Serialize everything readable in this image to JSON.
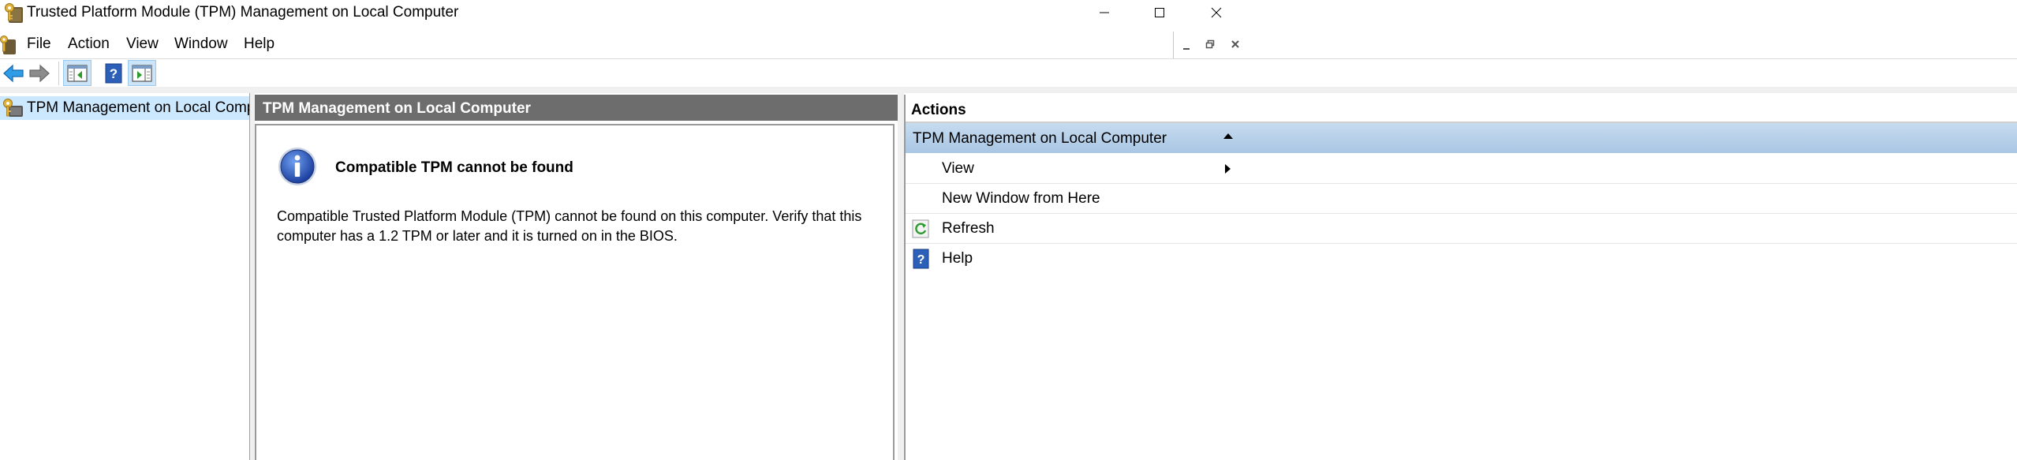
{
  "window": {
    "title": "Trusted Platform Module (TPM) Management on Local Computer",
    "app_icon": "tpm-key-icon",
    "controls": [
      "minimize-icon",
      "maximize-icon",
      "close-icon"
    ]
  },
  "menu": {
    "items": [
      "File",
      "Action",
      "View",
      "Window",
      "Help"
    ],
    "mdi_controls": [
      "mdi-minimize-icon",
      "mdi-restore-icon",
      "mdi-close-icon"
    ]
  },
  "toolbar": {
    "buttons": [
      "back-arrow-icon",
      "forward-arrow-icon",
      "show-hide-console-tree-icon",
      "help-icon",
      "show-hide-action-pane-icon"
    ]
  },
  "tree": {
    "items": [
      {
        "label": "TPM Management on Local Compute",
        "icon": "tpm-key-icon",
        "selected": true
      }
    ]
  },
  "center": {
    "header": "TPM Management on Local Computer",
    "message_title": "Compatible TPM cannot be found",
    "message_body": "Compatible Trusted Platform Module (TPM) cannot be found on this computer. Verify that this computer has a 1.2 TPM or later and it is turned on in the BIOS.",
    "icon": "info-icon"
  },
  "actions": {
    "header": "Actions",
    "group": "TPM Management on Local Computer",
    "items": [
      {
        "label": "View",
        "icon": "",
        "submenu": true
      },
      {
        "label": "New Window from Here",
        "icon": "",
        "submenu": false
      },
      {
        "label": "Refresh",
        "icon": "refresh-icon",
        "submenu": false
      },
      {
        "label": "Help",
        "icon": "help-icon",
        "submenu": false
      }
    ]
  },
  "colors": {
    "center_header_bg": "#6d6d6d",
    "tree_selection": "#cce8ff",
    "actions_group_bg": "#b4cfe9",
    "toolbar_active": "#cce4f7"
  }
}
